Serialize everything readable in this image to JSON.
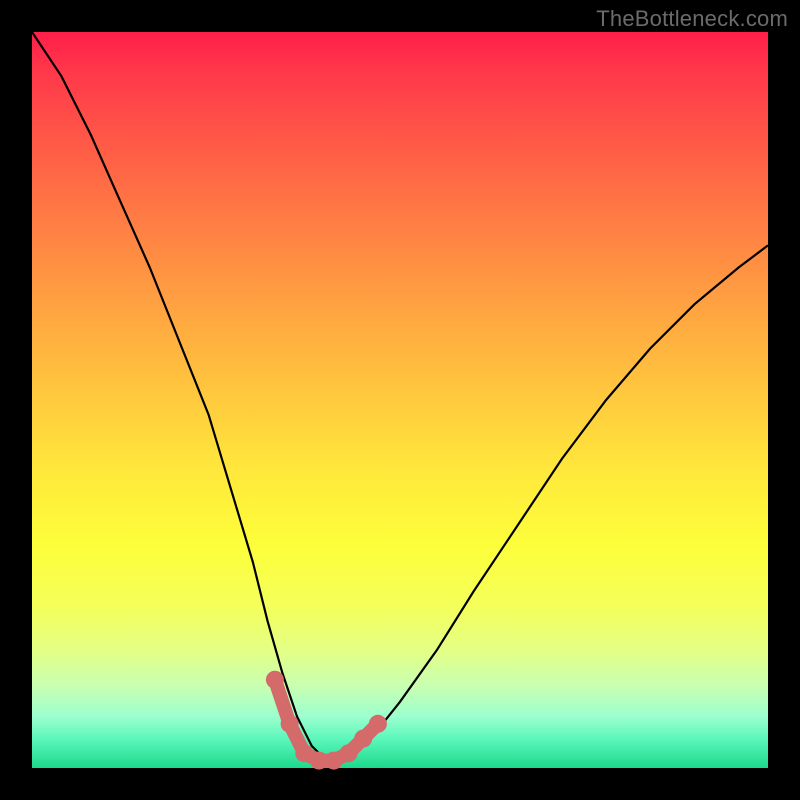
{
  "watermark": "TheBottleneck.com",
  "colors": {
    "frame": "#000000",
    "curve": "#000000",
    "marker": "#d46a6a",
    "gradient_css": "linear-gradient(to bottom, #ff1f49 0%, #ff3a4a 6%, #ff6a45 20%, #ff9842 34%, #ffc43e 48%, #ffe93b 60%, #fdff3b 70%, #f4ff5a 78%, #e4ff86 84%, #c7ffb2 89%, #9cffcf 93%, #5cf7bb 96%, #1dd98c 100%)"
  },
  "chart_data": {
    "type": "line",
    "title": "",
    "xlabel": "",
    "ylabel": "",
    "xlim": [
      0,
      100
    ],
    "ylim": [
      0,
      100
    ],
    "series": [
      {
        "name": "bottleneck-curve",
        "x": [
          0,
          4,
          8,
          12,
          16,
          20,
          24,
          27,
          30,
          32,
          34,
          36,
          38,
          40,
          42,
          44,
          46,
          50,
          55,
          60,
          66,
          72,
          78,
          84,
          90,
          96,
          100
        ],
        "y": [
          100,
          94,
          86,
          77,
          68,
          58,
          48,
          38,
          28,
          20,
          13,
          7,
          3,
          1,
          1,
          2,
          4,
          9,
          16,
          24,
          33,
          42,
          50,
          57,
          63,
          68,
          71
        ]
      }
    ],
    "markers": {
      "name": "bottom-markers",
      "x": [
        33,
        35,
        37,
        39,
        41,
        43,
        45,
        47
      ],
      "y": [
        12,
        6,
        2,
        1,
        1,
        2,
        4,
        6
      ]
    }
  }
}
